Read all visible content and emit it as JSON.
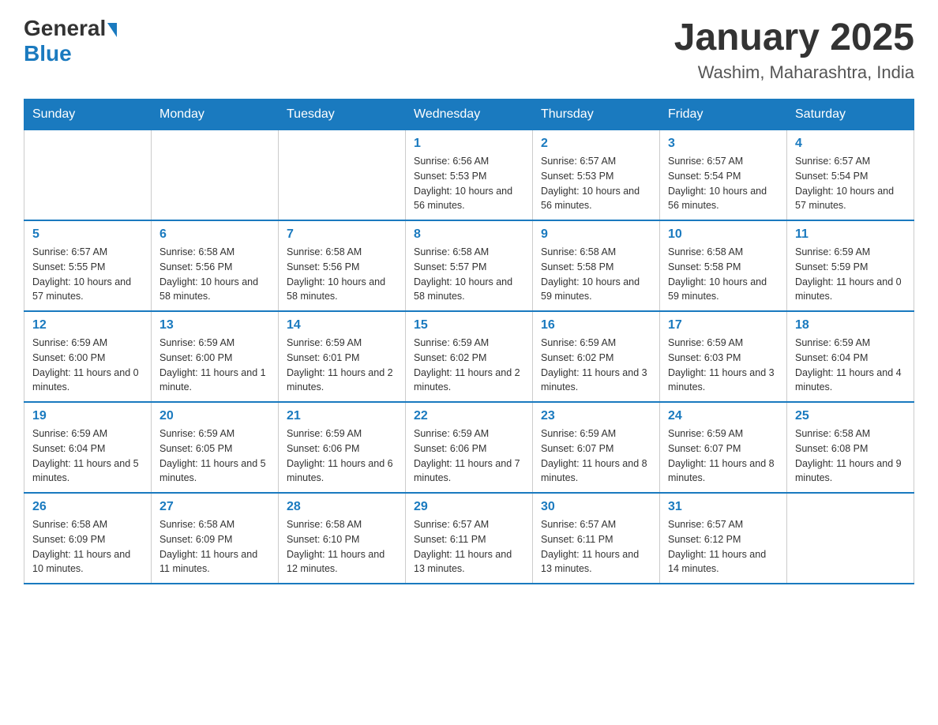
{
  "header": {
    "logo_general": "General",
    "logo_blue": "Blue",
    "month_title": "January 2025",
    "location": "Washim, Maharashtra, India"
  },
  "days_of_week": [
    "Sunday",
    "Monday",
    "Tuesday",
    "Wednesday",
    "Thursday",
    "Friday",
    "Saturday"
  ],
  "weeks": [
    [
      {
        "day": "",
        "info": ""
      },
      {
        "day": "",
        "info": ""
      },
      {
        "day": "",
        "info": ""
      },
      {
        "day": "1",
        "info": "Sunrise: 6:56 AM\nSunset: 5:53 PM\nDaylight: 10 hours and 56 minutes."
      },
      {
        "day": "2",
        "info": "Sunrise: 6:57 AM\nSunset: 5:53 PM\nDaylight: 10 hours and 56 minutes."
      },
      {
        "day": "3",
        "info": "Sunrise: 6:57 AM\nSunset: 5:54 PM\nDaylight: 10 hours and 56 minutes."
      },
      {
        "day": "4",
        "info": "Sunrise: 6:57 AM\nSunset: 5:54 PM\nDaylight: 10 hours and 57 minutes."
      }
    ],
    [
      {
        "day": "5",
        "info": "Sunrise: 6:57 AM\nSunset: 5:55 PM\nDaylight: 10 hours and 57 minutes."
      },
      {
        "day": "6",
        "info": "Sunrise: 6:58 AM\nSunset: 5:56 PM\nDaylight: 10 hours and 58 minutes."
      },
      {
        "day": "7",
        "info": "Sunrise: 6:58 AM\nSunset: 5:56 PM\nDaylight: 10 hours and 58 minutes."
      },
      {
        "day": "8",
        "info": "Sunrise: 6:58 AM\nSunset: 5:57 PM\nDaylight: 10 hours and 58 minutes."
      },
      {
        "day": "9",
        "info": "Sunrise: 6:58 AM\nSunset: 5:58 PM\nDaylight: 10 hours and 59 minutes."
      },
      {
        "day": "10",
        "info": "Sunrise: 6:58 AM\nSunset: 5:58 PM\nDaylight: 10 hours and 59 minutes."
      },
      {
        "day": "11",
        "info": "Sunrise: 6:59 AM\nSunset: 5:59 PM\nDaylight: 11 hours and 0 minutes."
      }
    ],
    [
      {
        "day": "12",
        "info": "Sunrise: 6:59 AM\nSunset: 6:00 PM\nDaylight: 11 hours and 0 minutes."
      },
      {
        "day": "13",
        "info": "Sunrise: 6:59 AM\nSunset: 6:00 PM\nDaylight: 11 hours and 1 minute."
      },
      {
        "day": "14",
        "info": "Sunrise: 6:59 AM\nSunset: 6:01 PM\nDaylight: 11 hours and 2 minutes."
      },
      {
        "day": "15",
        "info": "Sunrise: 6:59 AM\nSunset: 6:02 PM\nDaylight: 11 hours and 2 minutes."
      },
      {
        "day": "16",
        "info": "Sunrise: 6:59 AM\nSunset: 6:02 PM\nDaylight: 11 hours and 3 minutes."
      },
      {
        "day": "17",
        "info": "Sunrise: 6:59 AM\nSunset: 6:03 PM\nDaylight: 11 hours and 3 minutes."
      },
      {
        "day": "18",
        "info": "Sunrise: 6:59 AM\nSunset: 6:04 PM\nDaylight: 11 hours and 4 minutes."
      }
    ],
    [
      {
        "day": "19",
        "info": "Sunrise: 6:59 AM\nSunset: 6:04 PM\nDaylight: 11 hours and 5 minutes."
      },
      {
        "day": "20",
        "info": "Sunrise: 6:59 AM\nSunset: 6:05 PM\nDaylight: 11 hours and 5 minutes."
      },
      {
        "day": "21",
        "info": "Sunrise: 6:59 AM\nSunset: 6:06 PM\nDaylight: 11 hours and 6 minutes."
      },
      {
        "day": "22",
        "info": "Sunrise: 6:59 AM\nSunset: 6:06 PM\nDaylight: 11 hours and 7 minutes."
      },
      {
        "day": "23",
        "info": "Sunrise: 6:59 AM\nSunset: 6:07 PM\nDaylight: 11 hours and 8 minutes."
      },
      {
        "day": "24",
        "info": "Sunrise: 6:59 AM\nSunset: 6:07 PM\nDaylight: 11 hours and 8 minutes."
      },
      {
        "day": "25",
        "info": "Sunrise: 6:58 AM\nSunset: 6:08 PM\nDaylight: 11 hours and 9 minutes."
      }
    ],
    [
      {
        "day": "26",
        "info": "Sunrise: 6:58 AM\nSunset: 6:09 PM\nDaylight: 11 hours and 10 minutes."
      },
      {
        "day": "27",
        "info": "Sunrise: 6:58 AM\nSunset: 6:09 PM\nDaylight: 11 hours and 11 minutes."
      },
      {
        "day": "28",
        "info": "Sunrise: 6:58 AM\nSunset: 6:10 PM\nDaylight: 11 hours and 12 minutes."
      },
      {
        "day": "29",
        "info": "Sunrise: 6:57 AM\nSunset: 6:11 PM\nDaylight: 11 hours and 13 minutes."
      },
      {
        "day": "30",
        "info": "Sunrise: 6:57 AM\nSunset: 6:11 PM\nDaylight: 11 hours and 13 minutes."
      },
      {
        "day": "31",
        "info": "Sunrise: 6:57 AM\nSunset: 6:12 PM\nDaylight: 11 hours and 14 minutes."
      },
      {
        "day": "",
        "info": ""
      }
    ]
  ]
}
